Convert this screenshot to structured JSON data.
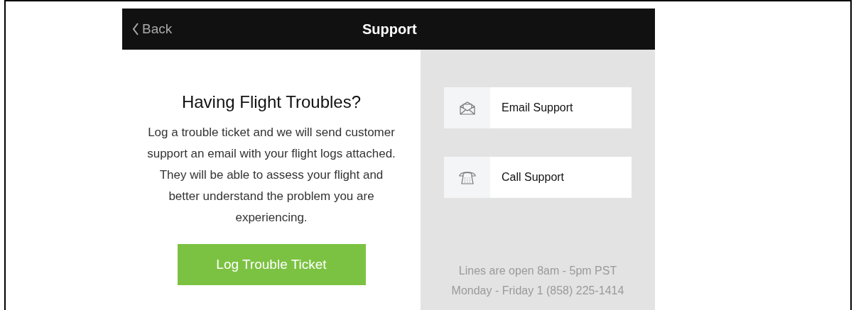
{
  "header": {
    "back": "Back",
    "title": "Support"
  },
  "intro": {
    "heading": "Having Flight Troubles?",
    "text": "Log a trouble ticket and we will send customer support an email with your flight logs attached. They will be able to assess your flight and better understand the problem you are experiencing.",
    "button": "Log Trouble Ticket"
  },
  "contacts": [
    {
      "kind": "email",
      "label": "Email Support"
    },
    {
      "kind": "phone",
      "label": "Call Support"
    }
  ],
  "hours": [
    "Lines are open 8am - 5pm PST",
    "Monday - Friday 1 (858) 225-1414"
  ]
}
